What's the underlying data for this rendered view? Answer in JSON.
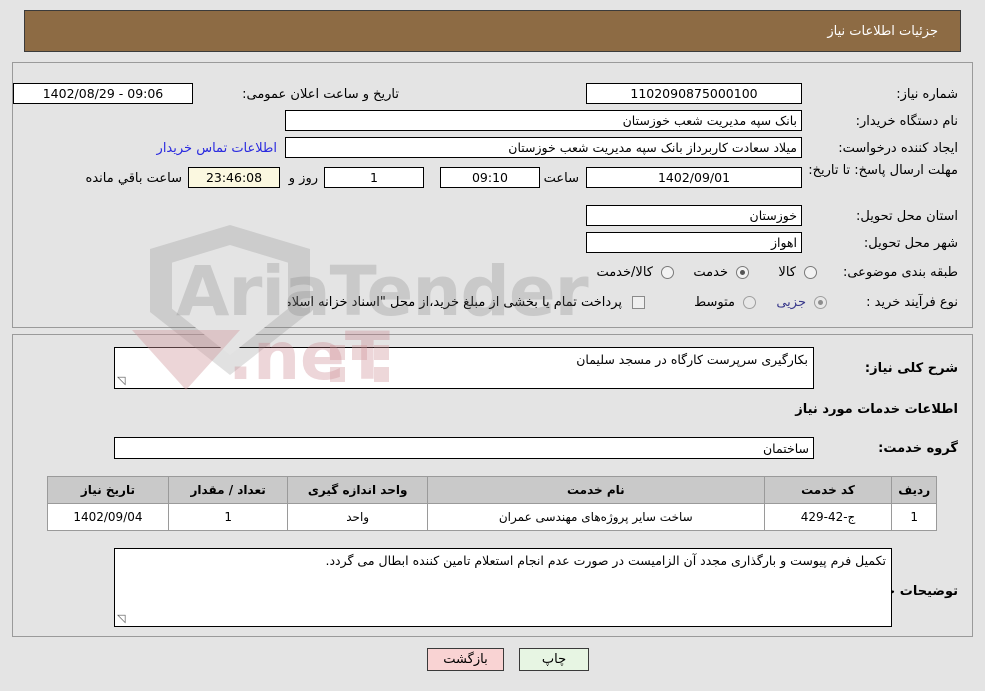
{
  "header": {
    "title": "جزئیات اطلاعات نیاز"
  },
  "top": {
    "labels": {
      "need_no": "شماره نیاز:",
      "buyer_org": "نام دستگاه خریدار:",
      "creator": "ایجاد کننده درخواست:",
      "deadline": "مهلت ارسال پاسخ: تا تاریخ:",
      "province": "استان محل تحویل:",
      "city": "شهر محل تحویل:",
      "category": "طبقه بندی موضوعی:",
      "purchase_type": "نوع فرآیند خرید :",
      "public_announce": "تاریخ و ساعت اعلان عمومی:",
      "hour": "ساعت",
      "day_and": "روز و",
      "remaining": "ساعت باقي مانده"
    },
    "values": {
      "need_no": "1102090875000100",
      "buyer_org": "بانک سپه مدیریت شعب خوزستان",
      "creator": "میلاد سعادت کاربرداز بانک سپه مدیریت شعب خوزستان",
      "deadline_date": "1402/09/01",
      "deadline_hour": "09:10",
      "days_left": "1",
      "time_left": "23:46:08",
      "province": "خوزستان",
      "city": "اهواز",
      "public_announce": "1402/08/29 - 09:06"
    },
    "contact_link": "اطلاعات تماس خریدار",
    "category_options": [
      {
        "label": "کالا",
        "selected": false
      },
      {
        "label": "خدمت",
        "selected": true
      },
      {
        "label": "کالا/خدمت",
        "selected": false
      }
    ],
    "purchase_options": [
      {
        "label": "جزیی",
        "selected": true
      },
      {
        "label": "متوسط",
        "selected": false
      }
    ],
    "treasury_note": "پرداخت تمام یا بخشی از مبلغ خرید،از محل \"اسناد خزانه اسلامی\" خواهد بود."
  },
  "mid": {
    "labels": {
      "general_desc": "شرح کلی نیاز:",
      "services_info": "اطلاعات خدمات مورد نیاز",
      "service_group": "گروه خدمت:",
      "buyer_notes": "توضیحات خریدار:"
    },
    "values": {
      "general_desc": "بکارگیری سرپرست کارگاه در مسجد سلیمان",
      "service_group": "ساختمان",
      "buyer_notes": "تکمیل فرم پیوست و بارگذاری مجدد آن الزامیست در صورت عدم انجام استعلام تامین کننده ابطال می گردد."
    }
  },
  "table": {
    "headers": [
      "ردیف",
      "کد خدمت",
      "نام خدمت",
      "واحد اندازه گیری",
      "تعداد / مقدار",
      "تاریخ نیاز"
    ],
    "rows": [
      {
        "row": "1",
        "code": "ج-42-429",
        "name": "ساخت سایر پروژه‌های مهندسی عمران",
        "unit": "واحد",
        "qty": "1",
        "need_date": "1402/09/04"
      }
    ]
  },
  "footer": {
    "print": "چاپ",
    "back": "بازگشت"
  },
  "watermark": {
    "brand_left": "AriaTender",
    "brand_right": ".neT"
  },
  "colors": {
    "header_bg": "#8d6b44",
    "page_bg": "#e4e4e4",
    "link": "#2a2adf",
    "back_btn": "#f9d3d3",
    "print_btn": "#e7f5e3",
    "table_header": "#c9c9c9",
    "countdown_bg": "#fbf8e0"
  }
}
